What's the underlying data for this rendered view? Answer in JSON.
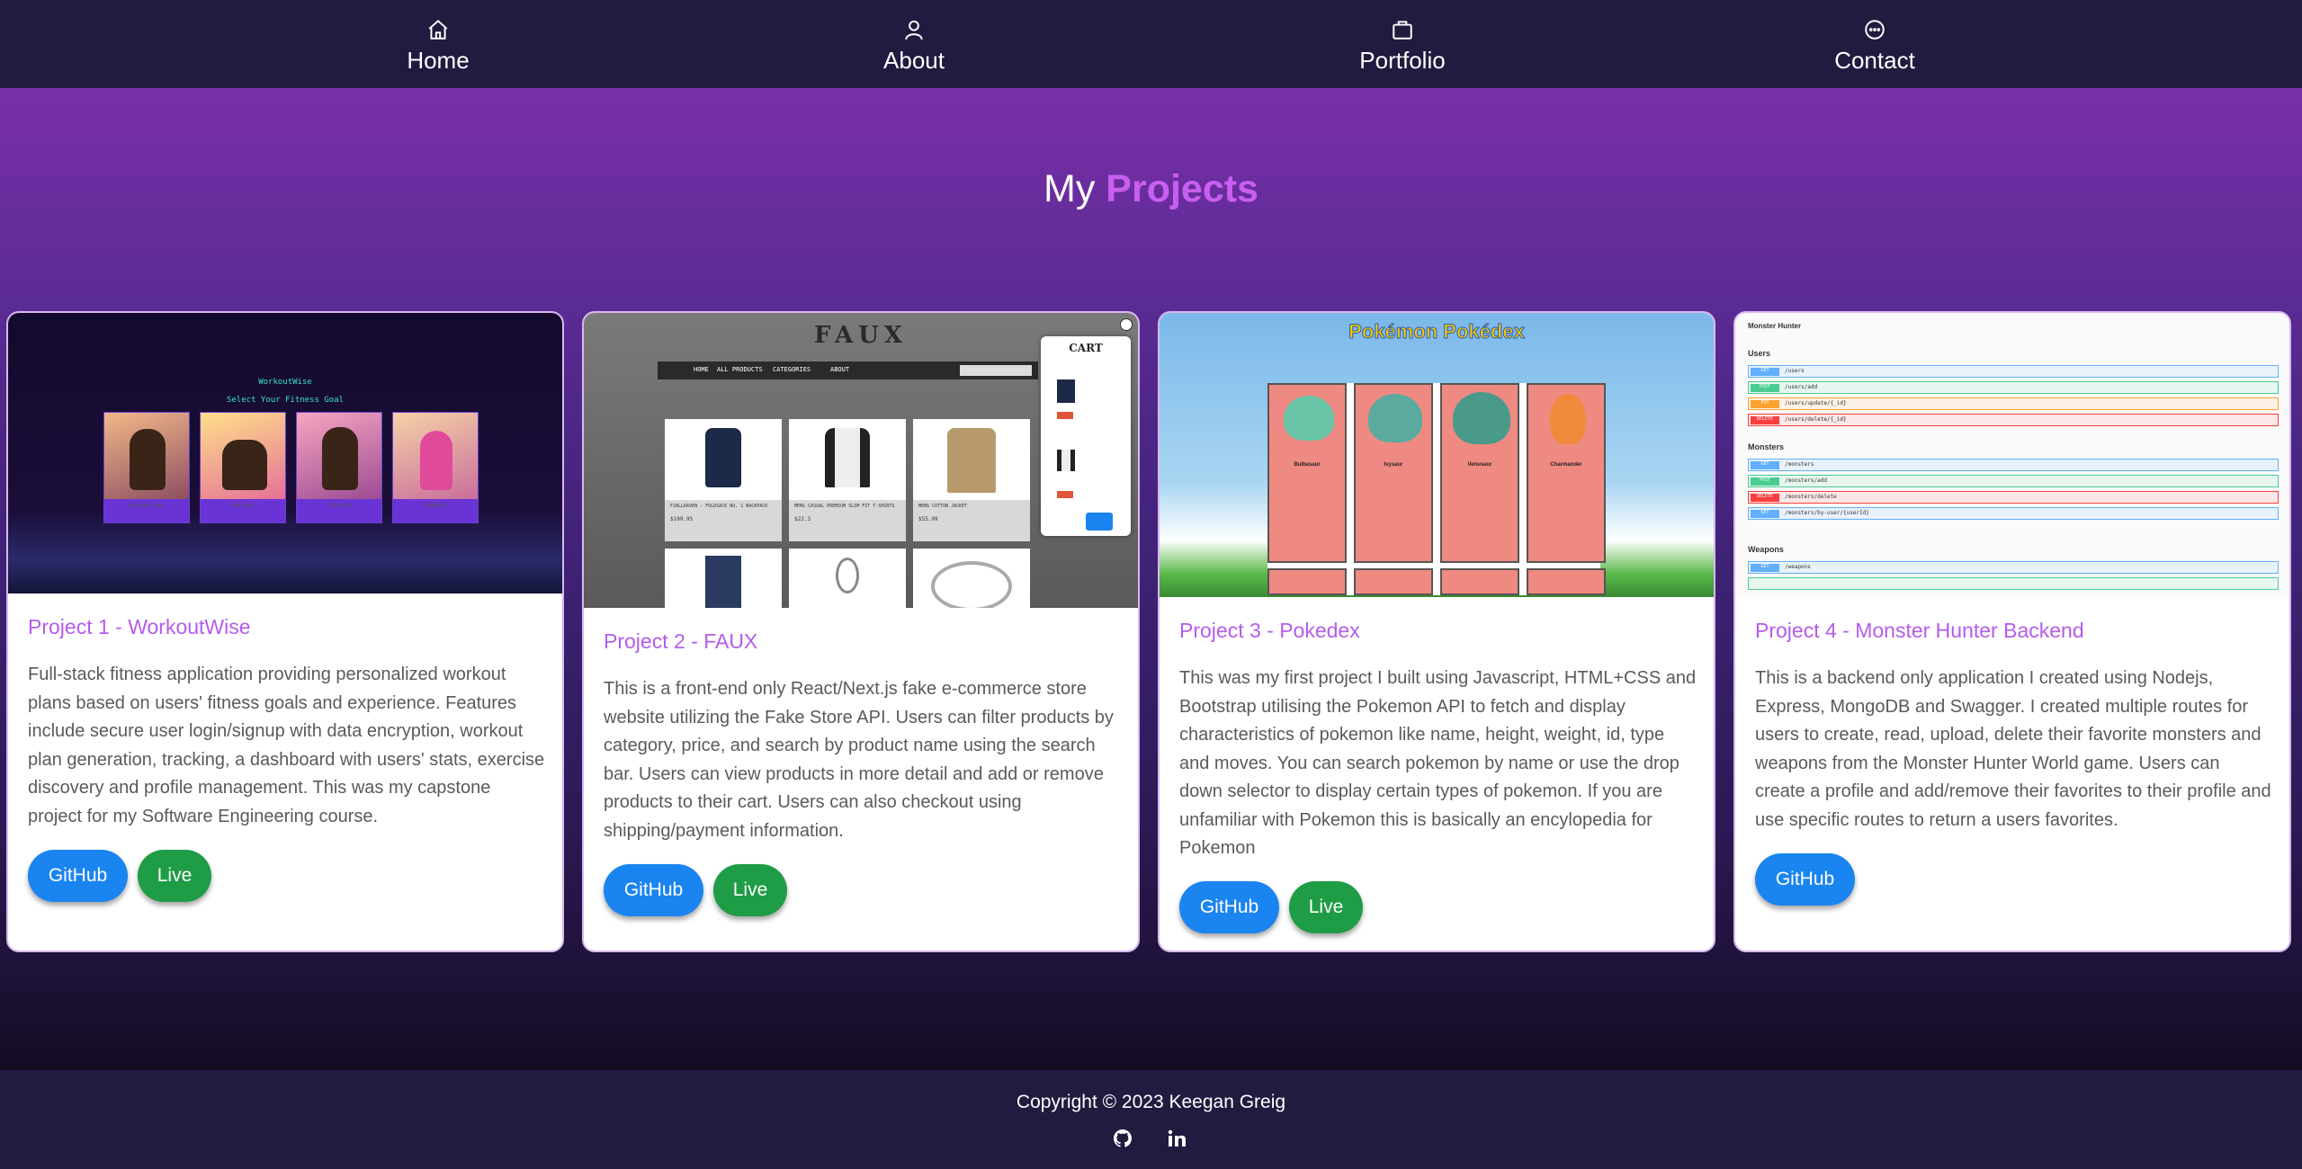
{
  "nav": {
    "items": [
      {
        "label": "Home",
        "icon": "home-icon"
      },
      {
        "label": "About",
        "icon": "user-icon"
      },
      {
        "label": "Portfolio",
        "icon": "briefcase-icon"
      },
      {
        "label": "Contact",
        "icon": "chat-icon"
      }
    ]
  },
  "heading": {
    "prefix": "My",
    "accent": "Projects"
  },
  "colors": {
    "accent": "#c85ff0",
    "github": "#1a84f0",
    "live": "#1f9c46",
    "nav": "#221a3f"
  },
  "projects": [
    {
      "title": "Project 1 - WorkoutWise",
      "description": "Full-stack fitness application providing personalized workout plans based on users' fitness goals and experience. Features include secure user login/signup with data encryption, workout plan generation, tracking, a dashboard with users' stats, exercise discovery and profile management. This was my capstone project for my Software Engineering course.",
      "github_label": "GitHub",
      "live_label": "Live",
      "screenshot": {
        "brand": "WorkoutWise",
        "subtitle": "Select Your Fitness Goal",
        "goals": [
          "Muscle Gain",
          "Fat Loss",
          "Tone up",
          "Mobility"
        ]
      }
    },
    {
      "title": "Project 2 - FAUX",
      "description": "This is a front-end only React/Next.js fake e-commerce store website utilizing the Fake Store API. Users can filter products by category, price, and search by product name using the search bar. Users can view products in more detail and add or remove products to their cart. Users can also checkout using shipping/payment information.",
      "github_label": "GitHub",
      "live_label": "Live",
      "screenshot": {
        "brand": "FAUX",
        "menu": [
          "HOME",
          "ALL PRODUCTS",
          "CATEGORIES",
          "ABOUT"
        ],
        "cart_title": "CART",
        "products": [
          "FJALLRAVEN - FOLDSACK NO. 1 BACKPACK",
          "MENS CASUAL PREMIUM SLIM FIT T-SHIRTS",
          "MENS COTTON JACKET"
        ],
        "prices": [
          "$109.95",
          "$22.3",
          "$55.99"
        ]
      }
    },
    {
      "title": "Project 3 - Pokedex",
      "description": "This was my first project I built using Javascript, HTML+CSS and Bootstrap utilising the Pokemon API to fetch and display characteristics of pokemon like name, height, weight, id, type and moves. You can search pokemon by name or use the drop down selector to display certain types of pokemon. If you are unfamiliar with Pokemon this is basically an encylopedia for Pokemon",
      "github_label": "GitHub",
      "live_label": "Live",
      "screenshot": {
        "brand": "Pokémon Pokédex",
        "pokemon": [
          "Bulbasaur",
          "Ivysaur",
          "Venusaur",
          "Charmander"
        ]
      }
    },
    {
      "title": "Project 4 - Monster Hunter Backend",
      "description": "This is a backend only application I created using Nodejs, Express, MongoDB and Swagger. I created multiple routes for users to create, read, upload, delete their favorite monsters and weapons from the Monster Hunter World game. Users can create a profile and add/remove their favorites to their profile and use specific routes to return a users favorites.",
      "github_label": "GitHub",
      "screenshot": {
        "brand": "Monster Hunter",
        "sections": [
          "Users",
          "Monsters",
          "Weapons"
        ],
        "routes": [
          {
            "method": "GET",
            "path": "/users"
          },
          {
            "method": "POST",
            "path": "/users/add"
          },
          {
            "method": "PUT",
            "path": "/users/update/{_id}"
          },
          {
            "method": "DELETE",
            "path": "/users/delete/{_id}"
          },
          {
            "method": "GET",
            "path": "/monsters"
          },
          {
            "method": "POST",
            "path": "/monsters/add"
          },
          {
            "method": "DELETE",
            "path": "/monsters/delete"
          },
          {
            "method": "GET",
            "path": "/monsters/by-user/{userId}"
          },
          {
            "method": "GET",
            "path": "/weapons"
          }
        ]
      }
    }
  ],
  "footer": {
    "copyright": "Copyright © 2023 Keegan Greig",
    "icons": [
      "github-icon",
      "linkedin-icon"
    ]
  }
}
